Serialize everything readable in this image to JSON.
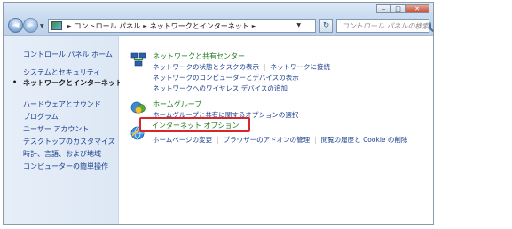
{
  "window": {
    "controls": {
      "minimize": "–",
      "maximize": "□",
      "close": "✕"
    }
  },
  "nav": {
    "back": "◄",
    "forward": "►",
    "recent": "▼"
  },
  "address": {
    "crumbs": [
      "コントロール パネル",
      "ネットワークとインターネット"
    ],
    "dropdown": "▼",
    "refresh": "↻"
  },
  "search": {
    "placeholder": "コントロール パネルの検索"
  },
  "sidebar": {
    "items": [
      {
        "label": "コントロール パネル ホーム",
        "current": false
      },
      {
        "label": "システムとセキュリティ",
        "current": false
      },
      {
        "label": "ネットワークとインターネット",
        "current": true
      },
      {
        "label": "ハードウェアとサウンド",
        "current": false
      },
      {
        "label": "プログラム",
        "current": false
      },
      {
        "label": "ユーザー アカウント",
        "current": false
      },
      {
        "label": "デスクトップのカスタマイズ",
        "current": false
      },
      {
        "label": "時計、言語、および地域",
        "current": false
      },
      {
        "label": "コンピューターの簡単操作",
        "current": false
      }
    ]
  },
  "categories": [
    {
      "title": "ネットワークと共有センター",
      "icon": "network-sharing-center-icon",
      "tasks": [
        [
          "ネットワークの状態とタスクの表示",
          "ネットワークに接続"
        ],
        [
          "ネットワークのコンピューターとデバイスの表示"
        ],
        [
          "ネットワークへのワイヤレス デバイスの追加"
        ]
      ]
    },
    {
      "title": "ホームグループ",
      "icon": "homegroup-icon",
      "tasks": [
        [
          "ホームグループと共有に関するオプションの選択"
        ]
      ]
    },
    {
      "title": "インターネット オプション",
      "icon": "internet-options-icon",
      "highlight_color": "#d8262d",
      "tasks": [
        [
          "ホームページの変更",
          "ブラウザーのアドオンの管理",
          "閲覧の履歴と Cookie の削除"
        ]
      ]
    }
  ]
}
